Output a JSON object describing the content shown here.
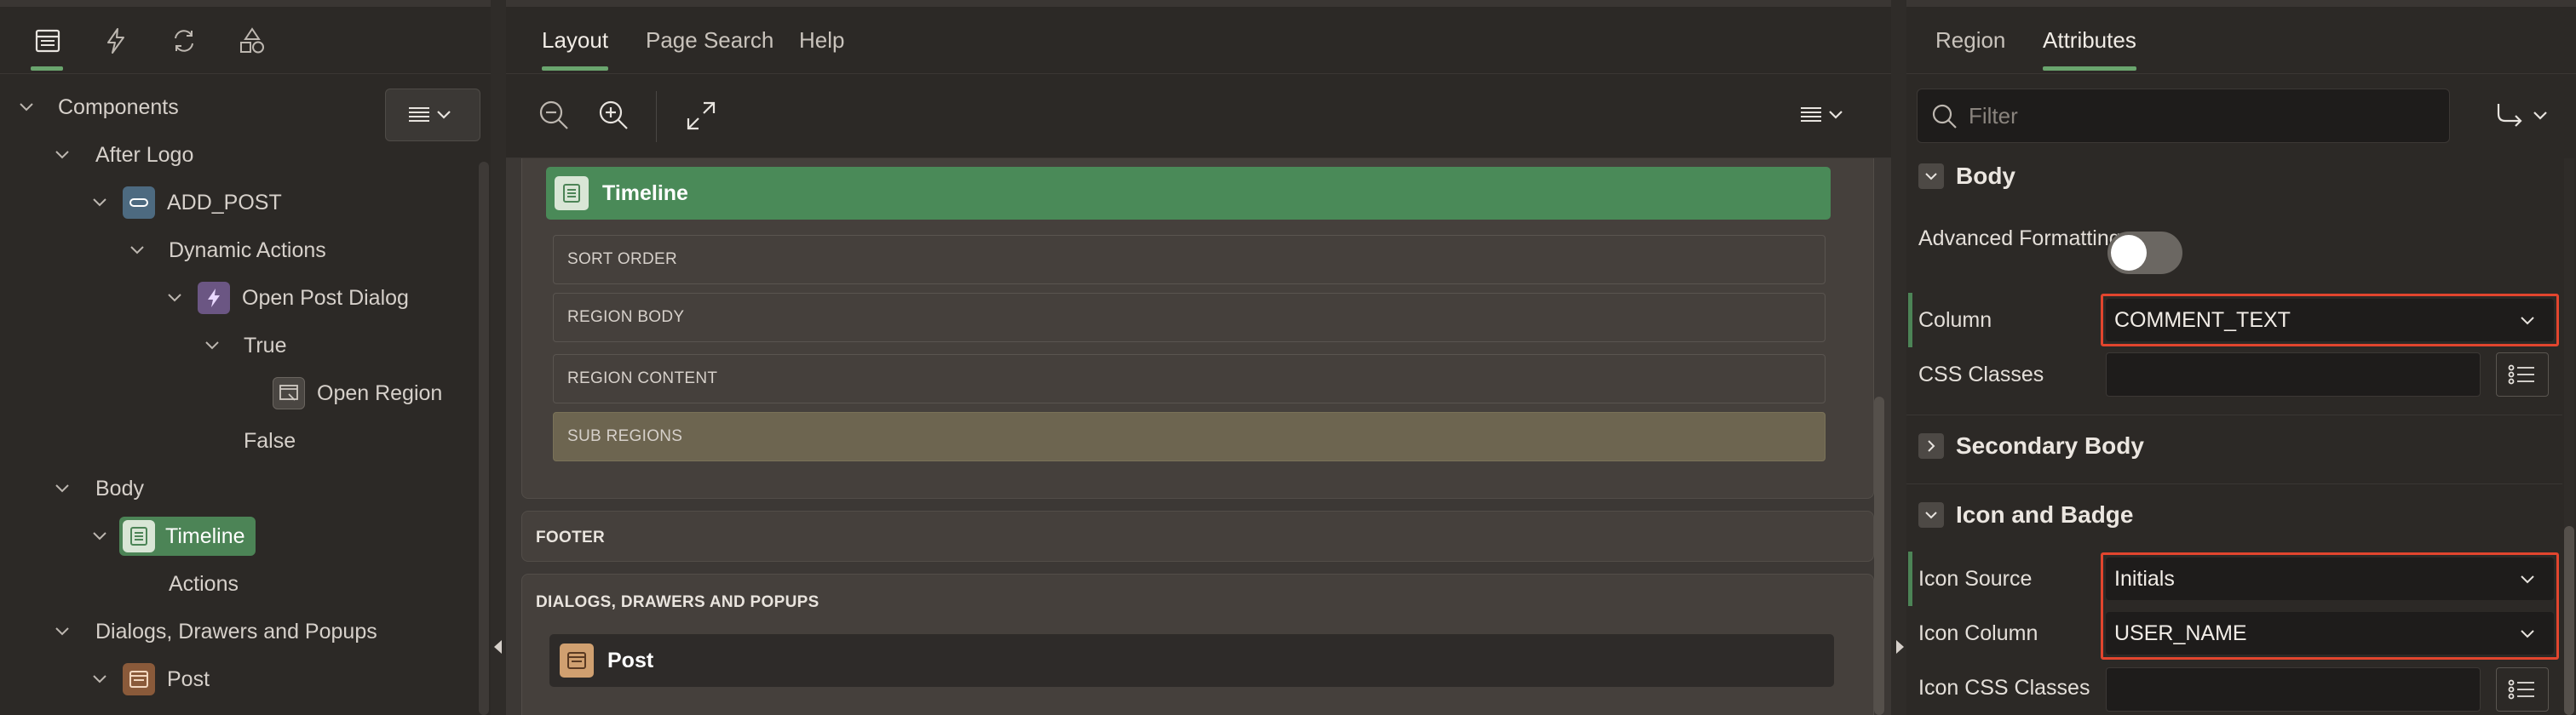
{
  "left": {
    "tabs": [
      {
        "name": "rendering-tab",
        "icon": "rendering-icon"
      },
      {
        "name": "dynamic-actions-tab",
        "icon": "lightning-icon"
      },
      {
        "name": "processing-tab",
        "icon": "refresh-icon"
      },
      {
        "name": "shared-components-tab",
        "icon": "shapes-icon"
      }
    ],
    "tree": [
      {
        "label": "Components"
      },
      {
        "label": "After Logo"
      },
      {
        "label": "ADD_POST"
      },
      {
        "label": "Dynamic Actions"
      },
      {
        "label": "Open Post Dialog"
      },
      {
        "label": "True"
      },
      {
        "label": "Open Region"
      },
      {
        "label": "False"
      },
      {
        "label": "Body"
      },
      {
        "label": "Timeline"
      },
      {
        "label": "Actions"
      },
      {
        "label": "Dialogs, Drawers and Popups"
      },
      {
        "label": "Post"
      }
    ]
  },
  "center": {
    "tabs": [
      {
        "label": "Layout"
      },
      {
        "label": "Page Search"
      },
      {
        "label": "Help"
      }
    ],
    "region": {
      "title": "Timeline"
    },
    "slots": [
      {
        "label": "SORT ORDER"
      },
      {
        "label": "REGION BODY"
      },
      {
        "label": "REGION CONTENT"
      },
      {
        "label": "SUB REGIONS"
      }
    ],
    "footer_label": "FOOTER",
    "dialogs_label": "DIALOGS, DRAWERS AND POPUPS",
    "dialog_region": {
      "title": "Post"
    }
  },
  "right": {
    "tabs": [
      {
        "label": "Region"
      },
      {
        "label": "Attributes"
      }
    ],
    "filter_placeholder": "Filter",
    "groups": {
      "body": "Body",
      "secondary_body": "Secondary Body",
      "icon_badge": "Icon and Badge"
    },
    "props": {
      "advanced_formatting": {
        "label": "Advanced Formatting",
        "on": false
      },
      "column": {
        "label": "Column",
        "value": "COMMENT_TEXT"
      },
      "css_classes": {
        "label": "CSS Classes",
        "value": ""
      },
      "icon_source": {
        "label": "Icon Source",
        "value": "Initials"
      },
      "icon_column": {
        "label": "Icon Column",
        "value": "USER_NAME"
      },
      "icon_css_classes": {
        "label": "Icon CSS Classes",
        "value": ""
      }
    },
    "highlight_color": "#e2452e"
  },
  "colors": {
    "accent": "#6aa56e",
    "selected_node": "#4c8456",
    "region_header": "#4a8a58"
  }
}
